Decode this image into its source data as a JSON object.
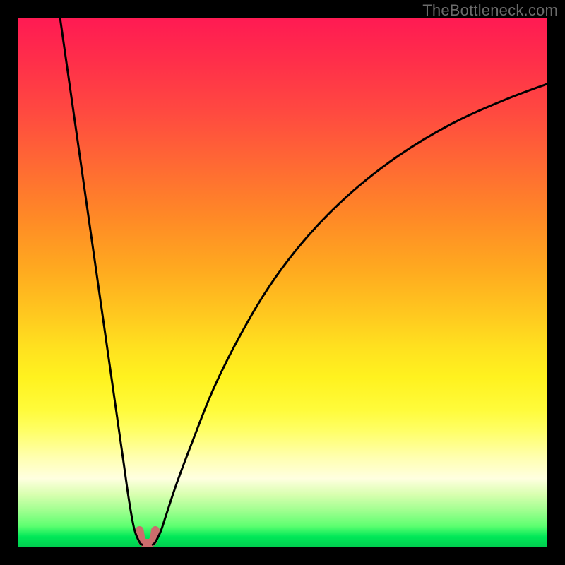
{
  "watermark": {
    "text": "TheBottleneck.com"
  },
  "chart_data": {
    "type": "line",
    "title": "",
    "xlabel": "",
    "ylabel": "",
    "xlim": [
      0,
      100
    ],
    "ylim": [
      0,
      100
    ],
    "series": [
      {
        "name": "left-branch",
        "x": [
          8,
          10,
          12,
          14,
          16,
          18,
          20,
          21,
          22,
          23,
          23.5
        ],
        "y": [
          100,
          86,
          72,
          58,
          44,
          30,
          16,
          9,
          3.5,
          1,
          0.5
        ]
      },
      {
        "name": "right-branch",
        "x": [
          25.5,
          26,
          27,
          28,
          30,
          33,
          37,
          42,
          48,
          55,
          63,
          72,
          82,
          92,
          100
        ],
        "y": [
          0.5,
          1,
          3,
          6,
          12,
          20,
          30,
          40,
          50,
          59,
          67,
          74,
          80,
          84.5,
          87.5
        ]
      },
      {
        "name": "valley-marker",
        "x": [
          23,
          23.3,
          23.8,
          24.5,
          25.2,
          25.7,
          26
        ],
        "y": [
          3.2,
          1.6,
          0.9,
          0.8,
          0.9,
          1.6,
          3.2
        ]
      }
    ],
    "colors": {
      "curve": "#000000",
      "valley_marker": "#cc6d6d",
      "gradient_top": "#ff1a53",
      "gradient_bottom": "#00cc4e"
    }
  }
}
